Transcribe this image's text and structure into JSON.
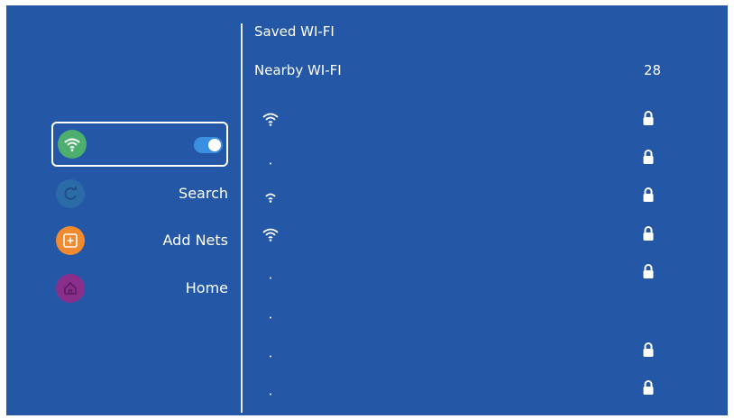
{
  "menu": {
    "items": [
      {
        "name": "wifi",
        "icon": "wifi-icon",
        "label": "",
        "toggle": true,
        "toggle_on": true,
        "color": "#4caf6e"
      },
      {
        "name": "search",
        "icon": "refresh-icon",
        "label": "Search",
        "color": "#2b6ba8"
      },
      {
        "name": "add-nets",
        "icon": "add-icon",
        "label": "Add Nets",
        "color": "#f28a30"
      },
      {
        "name": "home",
        "icon": "home-icon",
        "label": "Home",
        "color": "#8a2e8c"
      }
    ]
  },
  "networks": {
    "saved_title": "Saved WI-FI",
    "nearby_title": "Nearby WI-FI",
    "nearby_count": "28",
    "list": [
      {
        "signal": 3,
        "locked": true
      },
      {
        "signal": 0,
        "locked": true
      },
      {
        "signal": 2,
        "locked": true
      },
      {
        "signal": 3,
        "locked": true
      },
      {
        "signal": 0,
        "locked": true
      },
      {
        "signal": 0,
        "locked": false
      },
      {
        "signal": 0,
        "locked": true
      },
      {
        "signal": 0,
        "locked": true
      }
    ]
  },
  "colors": {
    "background": "#2457a5",
    "accent": "#3a8fe0"
  }
}
